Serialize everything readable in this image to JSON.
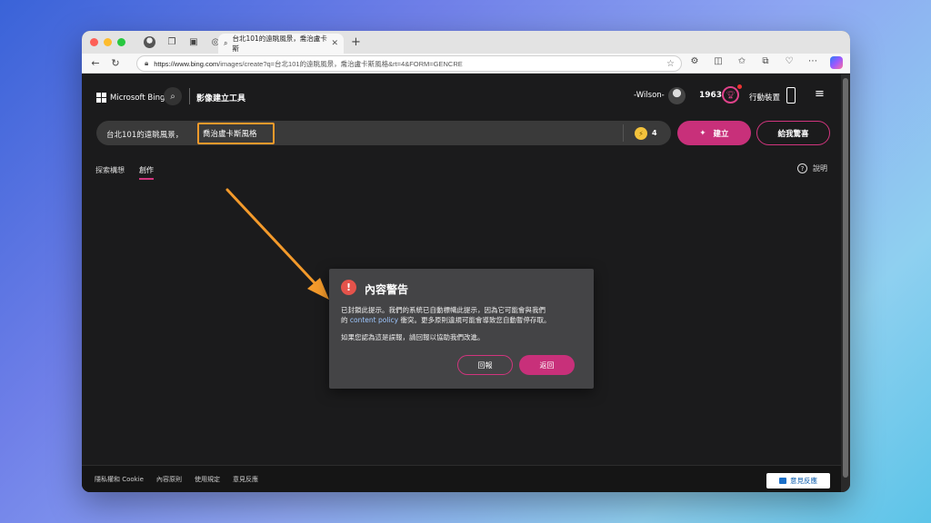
{
  "browser": {
    "tab_title": "台北101的遠眺風景，喬治盧卡斯",
    "url_domain": "https://www.bing.com",
    "url_path": "/images/create?q=台北101的遠眺風景，喬治盧卡斯風格&rt=4&FORM=GENCRE"
  },
  "header": {
    "brand": "Microsoft Bing",
    "tool_name": "影像建立工具",
    "user_name": "-Wilson-",
    "points": "1963",
    "mobile_label": "行動裝置"
  },
  "prompt": {
    "text": "台北101的遠眺風景，",
    "highlighted": "喬治盧卡斯風格",
    "boosts": "4",
    "create_label": "建立",
    "surprise_label": "給我驚喜"
  },
  "subtabs": {
    "explore": "探索構想",
    "creations": "創作",
    "help": "說明"
  },
  "dialog": {
    "title": "內容警告",
    "body_line1": "已封鎖此提示。我們的系統已自動標幟此提示，因為它可能會與我們",
    "body_pre": "的 ",
    "body_link": "content policy",
    "body_post": " 衝突。更多原則違規可能會導致您自動暫停存取。",
    "body_line3": "如果您認為這是誤報，請回報以協助我們改進。",
    "report_label": "回報",
    "back_label": "返回"
  },
  "footer": {
    "links": [
      "隱私權和 Cookie",
      "內容原則",
      "使用規定",
      "意見反應"
    ],
    "feedback_label": "意見反應"
  },
  "colors": {
    "accent_pink": "#c8307a",
    "annotation_orange": "#f39a2b",
    "warning_red": "#e5534b"
  }
}
